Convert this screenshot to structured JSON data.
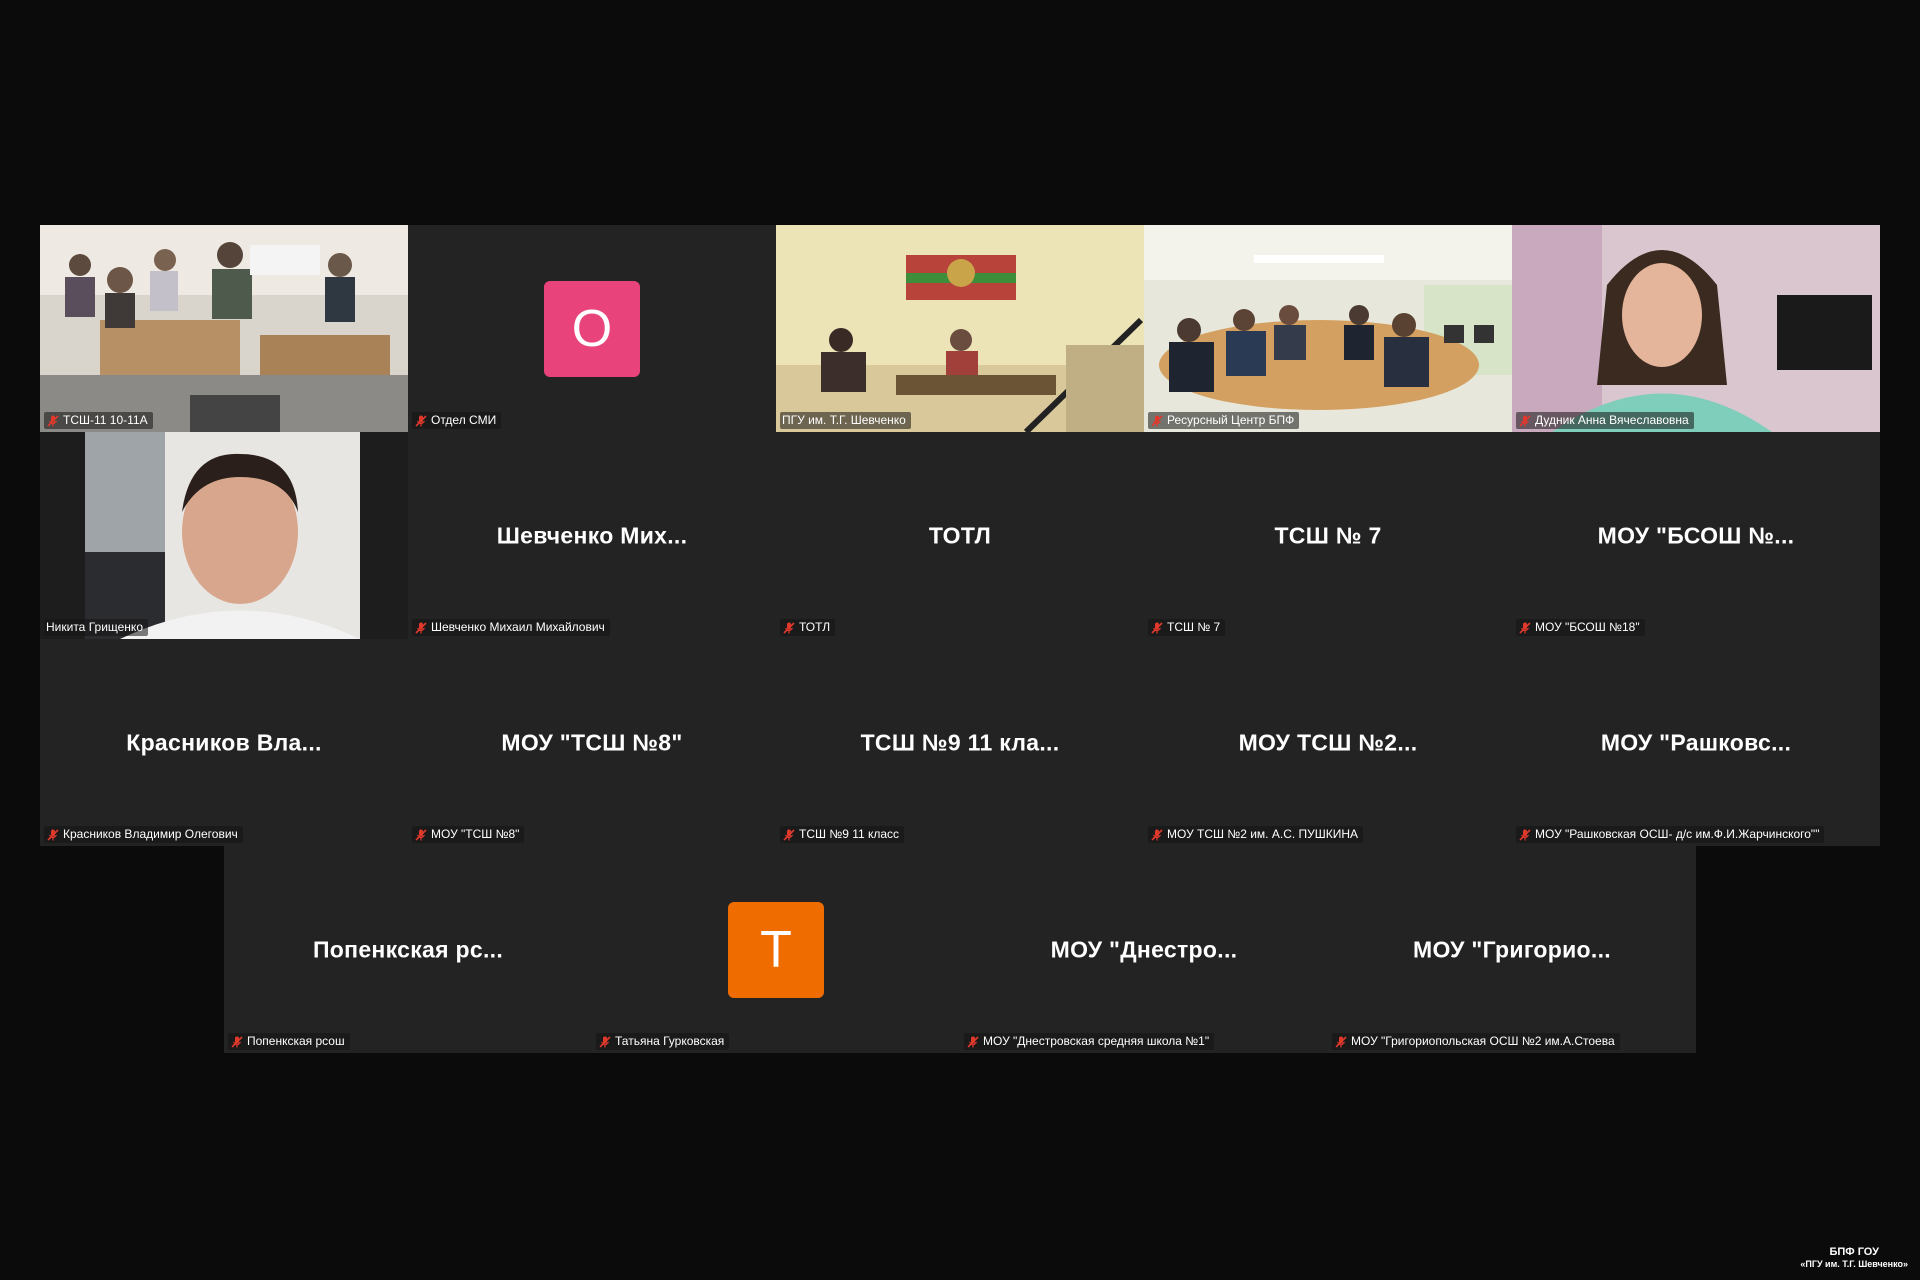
{
  "tiles": [
    {
      "type": "video",
      "scene": "classroom",
      "label": "ТСШ-11 10-11А"
    },
    {
      "type": "avatar",
      "letter": "О",
      "color": "#e8437a",
      "label": "Отдел СМИ"
    },
    {
      "type": "video",
      "scene": "hall",
      "label": "ПГУ им. Т.Г. Шевченко"
    },
    {
      "type": "video",
      "scene": "conference",
      "label": "Ресурсный Центр БПФ"
    },
    {
      "type": "video",
      "scene": "woman",
      "label": "Дудник Анна  Вячеславовна"
    },
    {
      "type": "video",
      "scene": "man",
      "label": "Никита Грищенко",
      "active": true
    },
    {
      "type": "name",
      "name": "Шевченко  Мих...",
      "label": "Шевченко Михаил Михайлович"
    },
    {
      "type": "name",
      "name": "ТОТЛ",
      "label": "ТОТЛ"
    },
    {
      "type": "name",
      "name": "ТСШ № 7",
      "label": "ТСШ № 7"
    },
    {
      "type": "name",
      "name": "МОУ  \"БСОШ  №...",
      "label": "МОУ \"БСОШ №18\""
    },
    {
      "type": "name",
      "name": "Красников  Вла...",
      "label": "Красников Владимир Олегович"
    },
    {
      "type": "name",
      "name": "МОУ  \"ТСШ  №8\"",
      "label": "МОУ \"ТСШ №8\""
    },
    {
      "type": "name",
      "name": "ТСШ  №9  11  кла...",
      "label": "ТСШ №9 11 класс"
    },
    {
      "type": "name",
      "name": "МОУ  ТСШ  №2...",
      "label": "МОУ ТСШ №2 им. А.С. ПУШКИНА"
    },
    {
      "type": "name",
      "name": "МОУ  \"Рашковс...",
      "label": "МОУ \"Рашковская ОСШ- д/с им.Ф.И.Жарчинского\"\""
    },
    {
      "type": "name",
      "name": "Попенкская  рс...",
      "label": "Попенкская рсош"
    },
    {
      "type": "avatar",
      "letter": "Т",
      "color": "#ef6c00",
      "label": "Татьяна Гурковская"
    },
    {
      "type": "name",
      "name": "МОУ  \"Днестро...",
      "label": "МОУ \"Днестровская средняя школа №1\""
    },
    {
      "type": "name",
      "name": "МОУ  \"Григорио...",
      "label": "МОУ \"Григориопольская ОСШ №2 им.А.Стоева"
    }
  ],
  "footer": {
    "line1": "БПФ ГОУ",
    "line2": "«ПГУ им. Т.Г. Шевченко»"
  },
  "colors": {
    "background": "#0b0b0b",
    "tile": "#232323",
    "active_border": "#23d18b",
    "mic_off": "#e0392c"
  }
}
